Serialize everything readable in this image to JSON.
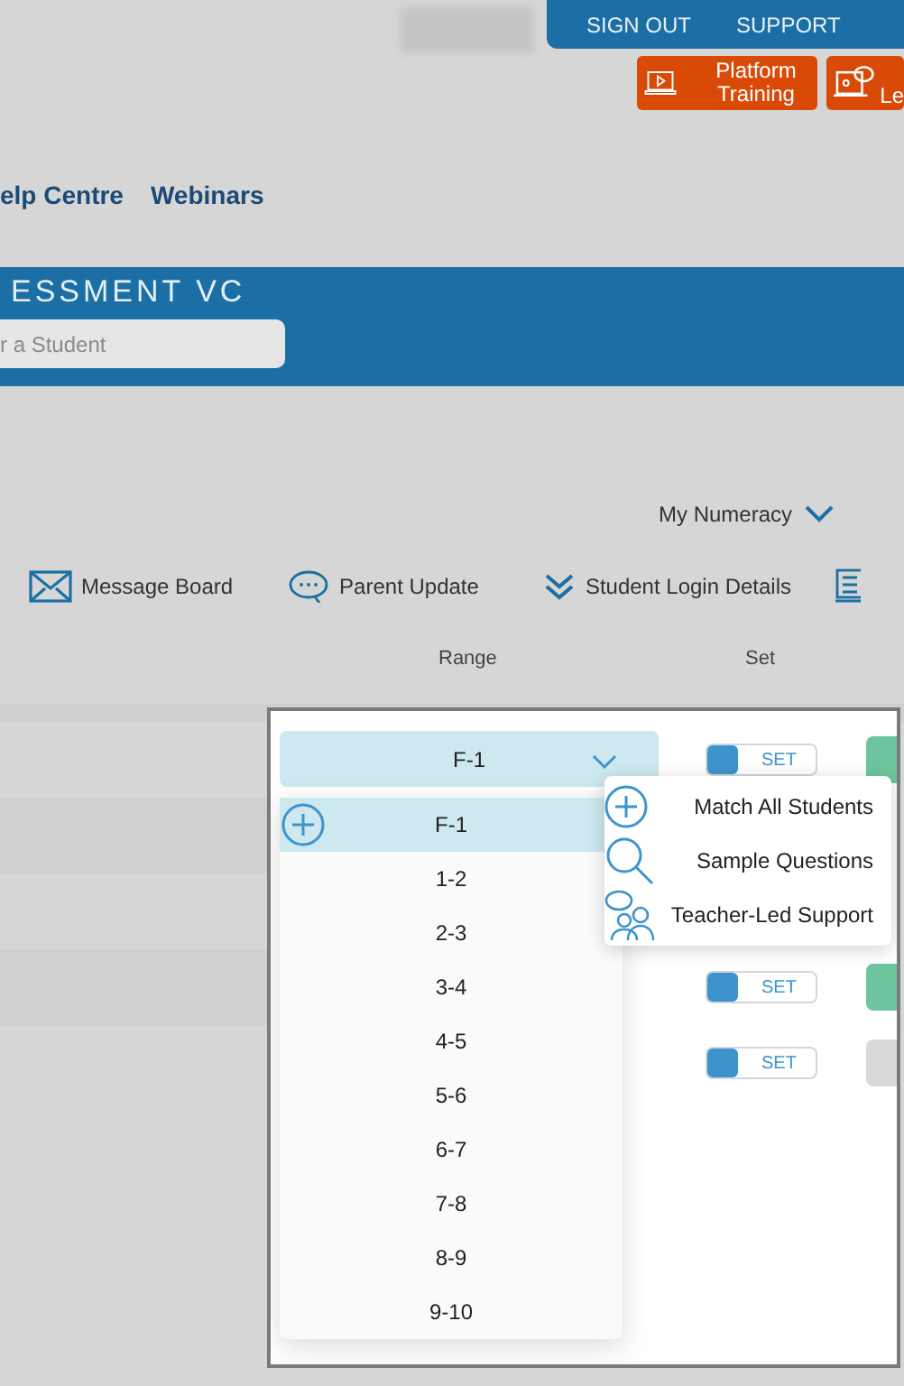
{
  "top_bar": {
    "links": [
      "SIGN OUT",
      "SUPPORT"
    ]
  },
  "training_buttons": [
    {
      "label": "Platform Training",
      "kind": "video"
    },
    {
      "label": "Le",
      "kind": "chat"
    }
  ],
  "nav_links": [
    "elp Centre",
    "Webinars"
  ],
  "banner": {
    "title": "ESSMENT VC",
    "search": {
      "placeholder": "r a Student"
    }
  },
  "subject_selector": {
    "label": "My Numeracy"
  },
  "toolbar": [
    {
      "label": "Message Board",
      "kind": "mail"
    },
    {
      "label": "Parent Update",
      "kind": "chat"
    },
    {
      "label": "Student Login Details",
      "kind": "chevrons"
    },
    {
      "kind": "list"
    }
  ],
  "columns": [
    "Range",
    "Set"
  ],
  "range_dropdown": {
    "value": "F-1",
    "expanded": true,
    "options": [
      {
        "label": "F-1",
        "selected": true
      },
      {
        "label": "1-2",
        "selected": false
      },
      {
        "label": "2-3",
        "selected": false
      },
      {
        "label": "3-4",
        "selected": false
      },
      {
        "label": "4-5",
        "selected": false
      },
      {
        "label": "5-6",
        "selected": false
      },
      {
        "label": "6-7",
        "selected": false
      },
      {
        "label": "7-8",
        "selected": false
      },
      {
        "label": "8-9",
        "selected": false
      },
      {
        "label": "9-10",
        "selected": false
      }
    ]
  },
  "table_rows": [
    {
      "set_label": "SET",
      "color": "#6ec59d"
    },
    {
      "set_label": "SET",
      "color": "#6ec59d"
    },
    {
      "set_label": "SET",
      "color": "#d9d9d9"
    }
  ],
  "context_menu": [
    {
      "label": "Match All Students",
      "kind": "plus"
    },
    {
      "label": "Sample Questions",
      "kind": "search"
    },
    {
      "label": "Teacher-Led Support",
      "kind": "people"
    }
  ]
}
